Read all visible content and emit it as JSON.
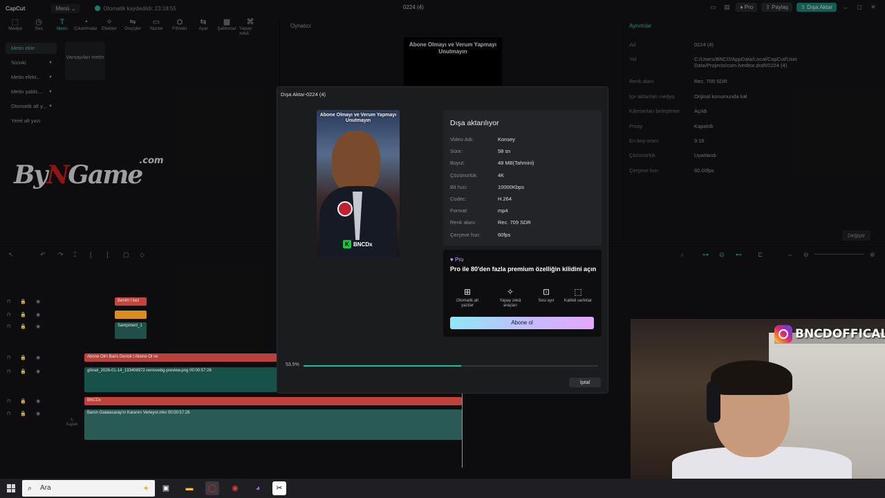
{
  "app": {
    "logo": "CapCut",
    "menu": "Menü",
    "autosave": "Otomatik kaydedildi: 23:18:55",
    "project": "0224 (4)",
    "pro": "Pro",
    "share": "Paylaş",
    "export": "Dışa Aktar"
  },
  "toolbar": [
    "Medya",
    "Ses",
    "Metin",
    "Çıkartmalar",
    "Efektler",
    "Geçişler",
    "Yazılar",
    "Filtreler",
    "Ayar",
    "Şablonlar",
    "Yapay zekâ"
  ],
  "toolbar_active": 2,
  "leftnav": [
    "Metin ekle",
    "Sizinki",
    "Metin efekt...",
    "Metin şablo...",
    "Otomatik alt y...",
    "Yerel alt yazı"
  ],
  "default_text_tile": "Varsayılan metin",
  "watermark": {
    "a": "By",
    "b": "N",
    "c": "Game",
    "sup": ".com"
  },
  "player": {
    "title": "Oynatıcı",
    "caption": "Abone Olmayı ve Verum Yapmayı Unutmayın"
  },
  "properties": {
    "title": "Ayrıntılar",
    "rows": [
      {
        "k": "Ad",
        "v": "0224 (4)"
      },
      {
        "k": "Yol",
        "v": "C:/Users/BNCD/AppData/Local/CapCut/User Data/Projects/com.lveditor.draft/0224 (4)"
      },
      {
        "k": "Renk alanı",
        "v": "Rec. 709 SDR"
      },
      {
        "k": "İçe aktarılan medya",
        "v": "Orijinal konumunda kal"
      },
      {
        "k": "Kâtmanları birleştirme",
        "v": "Açıldı"
      },
      {
        "k": "Proxy",
        "v": "Kapalıdı"
      },
      {
        "k": "En boy oranı",
        "v": "9:16"
      },
      {
        "k": "Çözünürlük",
        "v": "Uyarlandı"
      },
      {
        "k": "Çerçeve hızı",
        "v": "60.00fps"
      }
    ],
    "change": "Değiştir"
  },
  "timeline": {
    "tracks": [
      {
        "label": "Benim t kez",
        "color": "#c3453e"
      },
      {
        "label": "",
        "color": "#d98f1f"
      },
      {
        "label": "Sampment_1",
        "color": "#1f4f47"
      },
      {
        "label": "Abone Olm  Baris Dertok t  Abone Ol ve",
        "color": "#b9413b"
      },
      {
        "label": "görsel_2026-01-14_133408972-removebg-preview.png  00:00:57:26",
        "color": "#18504a"
      },
      {
        "label": "BNCDx",
        "color": "#c0403a"
      },
      {
        "label": "Baron Galatasaray'ın Kararını Verleyor.mkv  00:00:57:26",
        "color": "#2a5a55"
      }
    ],
    "cover": "Kapak"
  },
  "dialog": {
    "title": "Dışa Aktar-0224 (4)",
    "heading": "Dışa aktarılıyor",
    "thumb_caption": "Abone Olmayı ve Verum Yapmayı Unutmayın",
    "thumb_logo": "BNCDx",
    "info": [
      {
        "k": "Video Adı:",
        "v": "Konsey"
      },
      {
        "k": "Süre:",
        "v": "58 sn"
      },
      {
        "k": "Boyut:",
        "v": "48 MB(Tahmini)"
      },
      {
        "k": "Çözünürlük:",
        "v": "4K"
      },
      {
        "k": "Bit hızı:",
        "v": "10000Kbps"
      },
      {
        "k": "Codec:",
        "v": "H.264"
      },
      {
        "k": "Format:",
        "v": "mp4"
      },
      {
        "k": "Renk alanı:",
        "v": "Rec. 709 SDR"
      },
      {
        "k": "Çerçeve hızı:",
        "v": "60fps"
      }
    ],
    "pro_tag": "Pro",
    "pro_text": "Pro ile 80'den fazla premium özelliğin kilidini açın",
    "features": [
      "Otomatik alt yazılar",
      "Yapay zekâ araçları",
      "Sesi ayır",
      "Kaliteli varlıklar"
    ],
    "subscribe": "Abone ol",
    "progress_percent": 53.5,
    "progress_label": "53.5%",
    "cancel": "İptal"
  },
  "overlay": {
    "instagram": "BNCDOFFICAL"
  },
  "taskbar": {
    "search": "Ara"
  }
}
